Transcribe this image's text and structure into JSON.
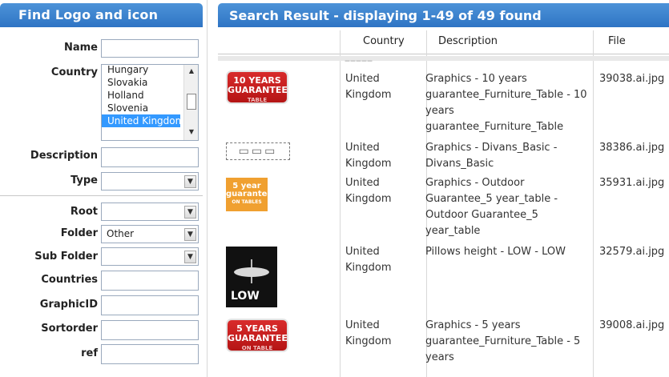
{
  "sidebar": {
    "title": "Find Logo and icon",
    "fields": {
      "name": "Name",
      "country": "Country",
      "description": "Description",
      "type": "Type",
      "root": "Root",
      "folder": "Folder",
      "subfolder": "Sub Folder",
      "countries": "Countries",
      "graphicid": "GraphicID",
      "sortorder": "Sortorder",
      "ref": "ref"
    },
    "country_options": [
      "Hungary",
      "Slovakia",
      "Holland",
      "Slovenia",
      "United Kingdom"
    ],
    "country_selected": "United Kingdom",
    "folder_value": "Other"
  },
  "results": {
    "title": "Search Result - displaying 1-49 of 49 found",
    "columns": {
      "country": "Country",
      "description": "Description",
      "file": "File"
    },
    "rows": [
      {
        "logo": "10 YEARS GUARANTEE TABLE",
        "logo_l1": "10 YEARS",
        "logo_l2": "GUARANTEE",
        "logo_l3": "TABLE",
        "country": "United Kingdom",
        "description": "Graphics - 10 years guarantee_Furniture_Table - 10 years guarantee_Furniture_Table",
        "file": "39038.ai.jpg"
      },
      {
        "logo": "dotted outline logo",
        "country": "United Kingdom",
        "description": "Graphics - Divans_Basic - Divans_Basic",
        "file": "38386.ai.jpg"
      },
      {
        "logo": "5 year guarantee ON TABLES",
        "logo_l1": "5 year",
        "logo_l2": "guarantee",
        "logo_l3": "ON TABLES",
        "country": "United Kingdom",
        "description": "Graphics - Outdoor Guarantee_5 year_table - Outdoor Guarantee_5 year_table",
        "file": "35931.ai.jpg"
      },
      {
        "logo": "LOW pillow icon",
        "logo_text": "LOW",
        "country": "United Kingdom",
        "description": "Pillows height - LOW - LOW",
        "file": "32579.ai.jpg"
      },
      {
        "logo": "5 YEARS GUARANTEE ON TABLE",
        "logo_l1": "5 YEARS",
        "logo_l2": "GUARANTEE",
        "logo_l3": "ON TABLE",
        "country": "United Kingdom",
        "description": "Graphics - 5 years guarantee_Furniture_Table - 5 years",
        "file": "39008.ai.jpg"
      }
    ]
  },
  "colors": {
    "header": "#3a82cc",
    "selected": "#3399ff",
    "badge_red": "#c81f1f",
    "badge_orange": "#f0a030"
  }
}
